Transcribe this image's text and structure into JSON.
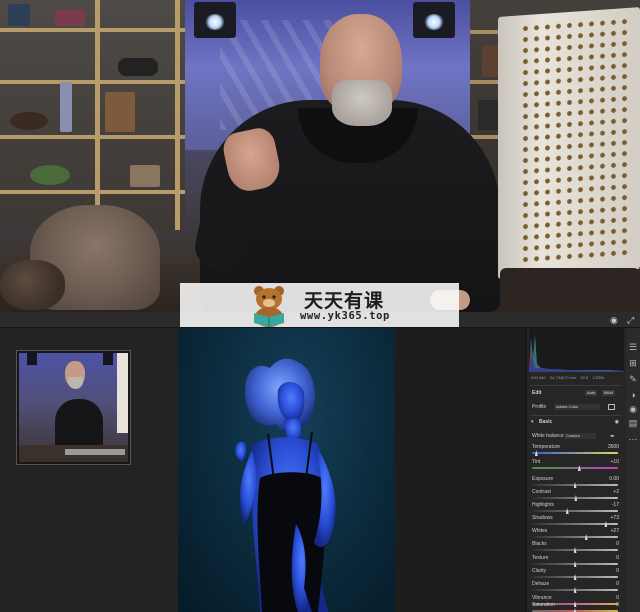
{
  "watermark": {
    "title": "天天有课",
    "url": "www.yk365.top"
  },
  "editor": {
    "panel": {
      "metadata": [
        "ISO 640",
        "24-70@70 mm",
        "f/2.8",
        "1/250s"
      ],
      "edit_tab": "Edit",
      "auto_button": "Auto",
      "bw_button": "B&W",
      "profile_label": "Profile",
      "profile_value": "Adobe Color",
      "basic_header": "Basic",
      "white_balance_label": "White balance",
      "white_balance_value": "Custom",
      "sliders": [
        {
          "label": "Temperature",
          "value": "3500",
          "fraction": 0.05,
          "track": "temp"
        },
        {
          "label": "Tint",
          "value": "+10",
          "fraction": 0.55,
          "track": "tint"
        },
        {
          "label": "Exposure",
          "value": "0.00",
          "fraction": 0.5,
          "track": "gray"
        },
        {
          "label": "Contrast",
          "value": "+2",
          "fraction": 0.51,
          "track": "gray"
        },
        {
          "label": "Highlights",
          "value": "-17",
          "fraction": 0.41,
          "track": "gray"
        },
        {
          "label": "Shadows",
          "value": "+73",
          "fraction": 0.86,
          "track": "gray"
        },
        {
          "label": "Whites",
          "value": "+27",
          "fraction": 0.63,
          "track": "gray"
        },
        {
          "label": "Blacks",
          "value": "0",
          "fraction": 0.5,
          "track": "gray"
        },
        {
          "label": "Texture",
          "value": "0",
          "fraction": 0.5,
          "track": "gray"
        },
        {
          "label": "Clarity",
          "value": "0",
          "fraction": 0.5,
          "track": "gray"
        },
        {
          "label": "Dehaze",
          "value": "0",
          "fraction": 0.5,
          "track": "gray"
        },
        {
          "label": "Vibrance",
          "value": "0",
          "fraction": 0.5,
          "track": "vib"
        },
        {
          "label": "Saturation",
          "value": "0",
          "fraction": 0.5,
          "track": "sat"
        }
      ]
    },
    "colors": {
      "panel_bg": "#262626",
      "canvas_bg": "#1d1d1d",
      "photo_blue": "#2a4fd6"
    }
  }
}
